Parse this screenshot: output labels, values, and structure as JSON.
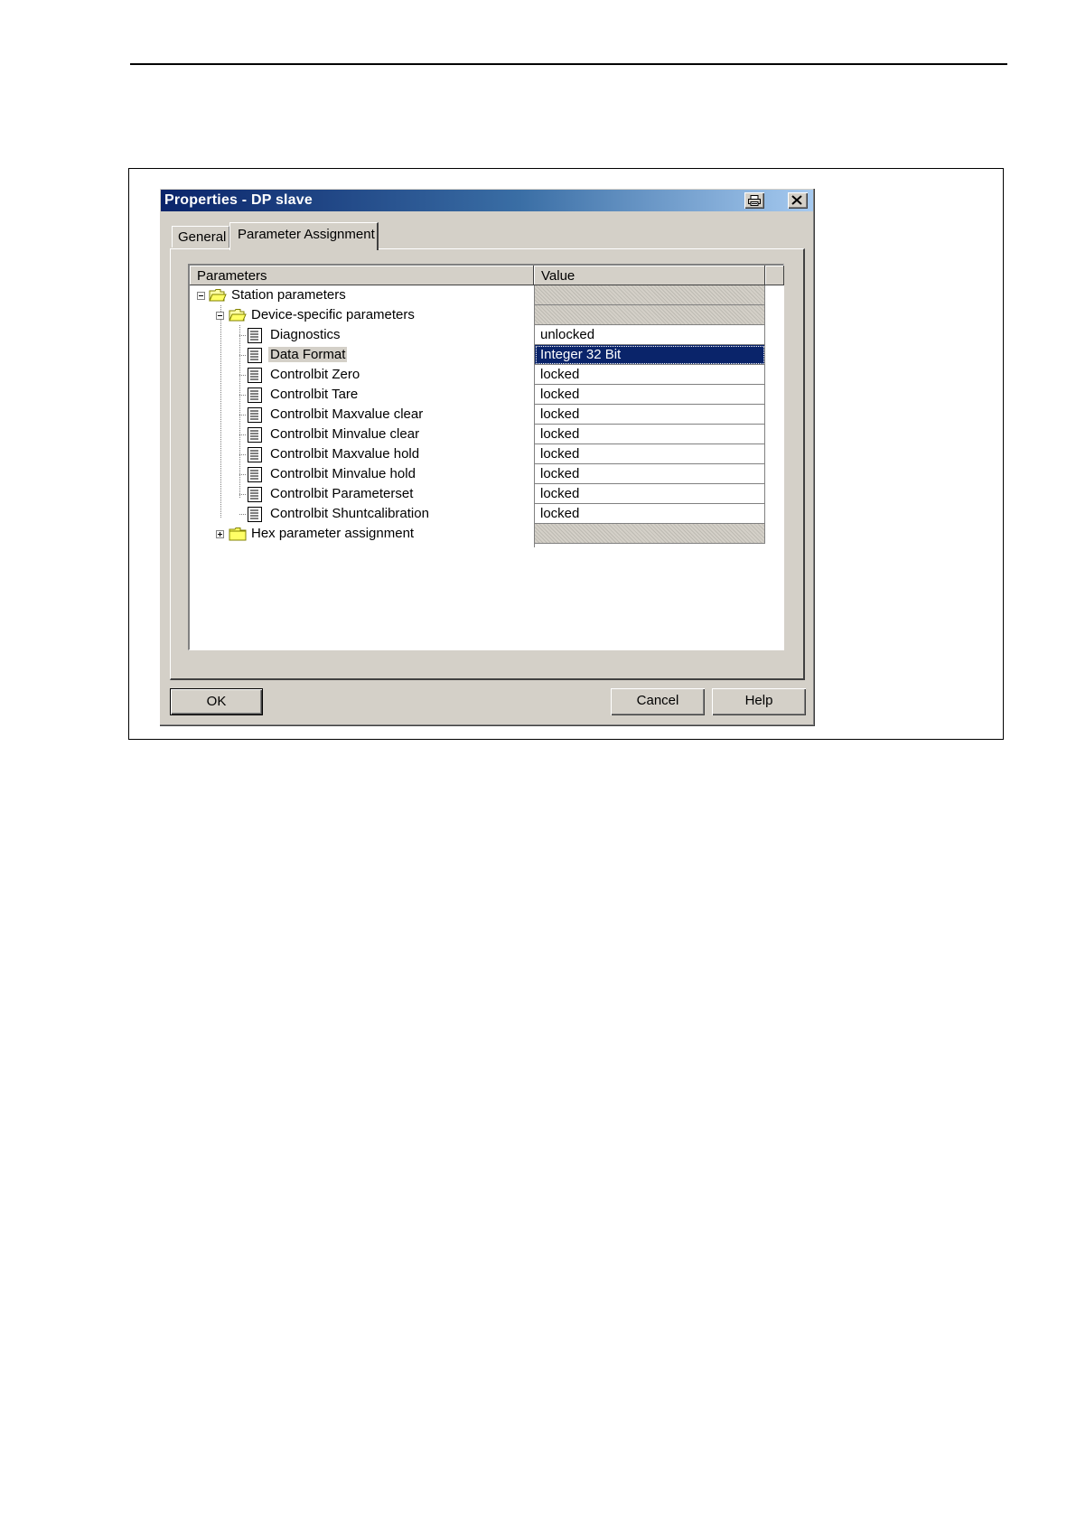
{
  "dialog": {
    "title": "Properties - DP slave",
    "tabs": [
      {
        "label": "General",
        "active": false
      },
      {
        "label": "Parameter Assignment",
        "active": true
      }
    ],
    "buttons": {
      "ok": "OK",
      "cancel": "Cancel",
      "help": "Help"
    }
  },
  "grid": {
    "columns": [
      "Parameters",
      "Value"
    ],
    "rows": [
      {
        "label": "Station parameters",
        "level": 0,
        "type": "folder",
        "expanded": true,
        "value": ""
      },
      {
        "label": "Device-specific parameters",
        "level": 1,
        "type": "folder",
        "expanded": true,
        "value": ""
      },
      {
        "label": "Diagnostics",
        "level": 2,
        "type": "param",
        "value": "unlocked"
      },
      {
        "label": "Data Format",
        "level": 2,
        "type": "param",
        "value": "Integer 32 Bit",
        "selected": true
      },
      {
        "label": "Controlbit Zero",
        "level": 2,
        "type": "param",
        "value": "locked"
      },
      {
        "label": "Controlbit Tare",
        "level": 2,
        "type": "param",
        "value": "locked"
      },
      {
        "label": "Controlbit Maxvalue clear",
        "level": 2,
        "type": "param",
        "value": "locked"
      },
      {
        "label": "Controlbit Minvalue clear",
        "level": 2,
        "type": "param",
        "value": "locked"
      },
      {
        "label": "Controlbit Maxvalue hold",
        "level": 2,
        "type": "param",
        "value": "locked"
      },
      {
        "label": "Controlbit Minvalue hold",
        "level": 2,
        "type": "param",
        "value": "locked"
      },
      {
        "label": "Controlbit Parameterset",
        "level": 2,
        "type": "param",
        "value": "locked"
      },
      {
        "label": "Controlbit Shuntcalibration",
        "level": 2,
        "type": "param",
        "value": "locked"
      },
      {
        "label": "Hex parameter assignment",
        "level": 1,
        "type": "folder",
        "expanded": false,
        "value": ""
      }
    ]
  },
  "colors": {
    "titlebar_start": "#0a246a",
    "titlebar_end": "#a6caf0",
    "selection": "#0a246a",
    "face": "#d4d0c8"
  },
  "icons": {
    "printer": "printer-icon",
    "close": "close-icon",
    "folder": "folder-icon",
    "param": "document-icon"
  }
}
